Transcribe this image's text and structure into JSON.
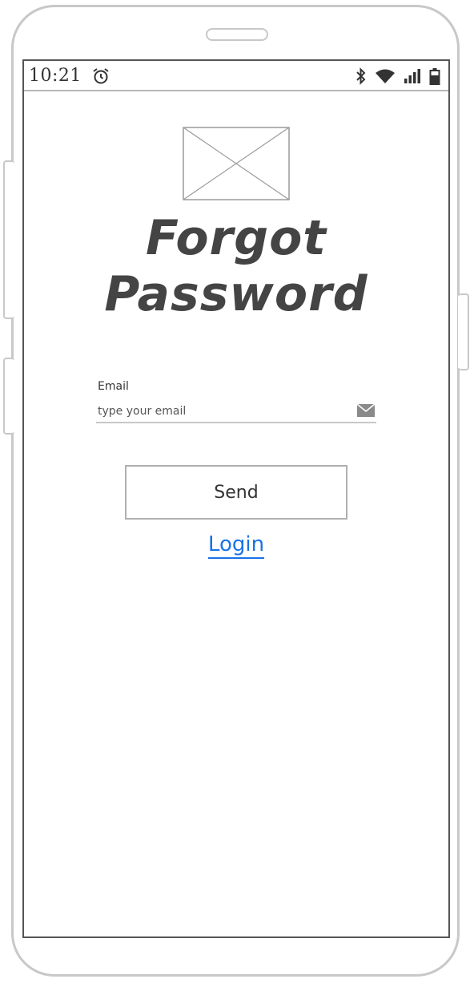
{
  "status_bar": {
    "time": "10:21",
    "icons": [
      "alarm-icon",
      "bluetooth-icon",
      "wifi-icon",
      "signal-icon",
      "battery-icon"
    ]
  },
  "page": {
    "title": "Forgot Password"
  },
  "form": {
    "email_label": "Email",
    "email_placeholder": "type your email",
    "email_value": "",
    "send_label": "Send"
  },
  "links": {
    "login_label": "Login"
  },
  "colors": {
    "link": "#1a73e8",
    "title": "#444444",
    "frame": "#c8c8c8"
  }
}
